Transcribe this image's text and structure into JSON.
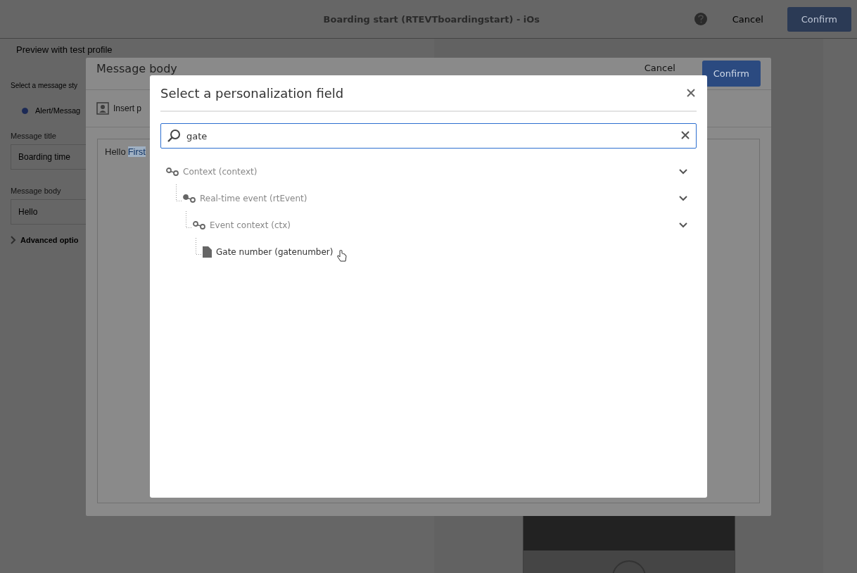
{
  "page": {
    "title": "Boarding start (RTEVTboardingstart) - iOs",
    "cancel": "Cancel",
    "confirm": "Confirm",
    "preview": "Preview with test profile",
    "style_label": "Select a message sty",
    "style_option": {
      "label": "Alert/Messag",
      "selected": true
    },
    "fields": [
      {
        "label": "Message title",
        "value": "Boarding time"
      },
      {
        "label": "Message body",
        "value": "Hello"
      }
    ],
    "advanced": {
      "label": "Advanced optio",
      "expanded": false
    }
  },
  "message_dialog": {
    "title": "Message body",
    "cancel": "Cancel",
    "confirm": "Confirm",
    "insert": "Insert p",
    "body_text": "Hello",
    "body_tag": "First"
  },
  "field_dialog": {
    "title": "Select a personalization field",
    "search": {
      "value": "gate"
    },
    "tree": [
      {
        "kind": "node",
        "label": "Context (context)",
        "expanded": true,
        "children": [
          {
            "kind": "node",
            "label": "Real-time event (rtEvent)",
            "expanded": true,
            "children": [
              {
                "kind": "node",
                "label": "Event context (ctx)",
                "expanded": true,
                "children": [
                  {
                    "kind": "field",
                    "label": "Gate number (gatenumber)"
                  }
                ]
              }
            ]
          }
        ]
      }
    ]
  }
}
